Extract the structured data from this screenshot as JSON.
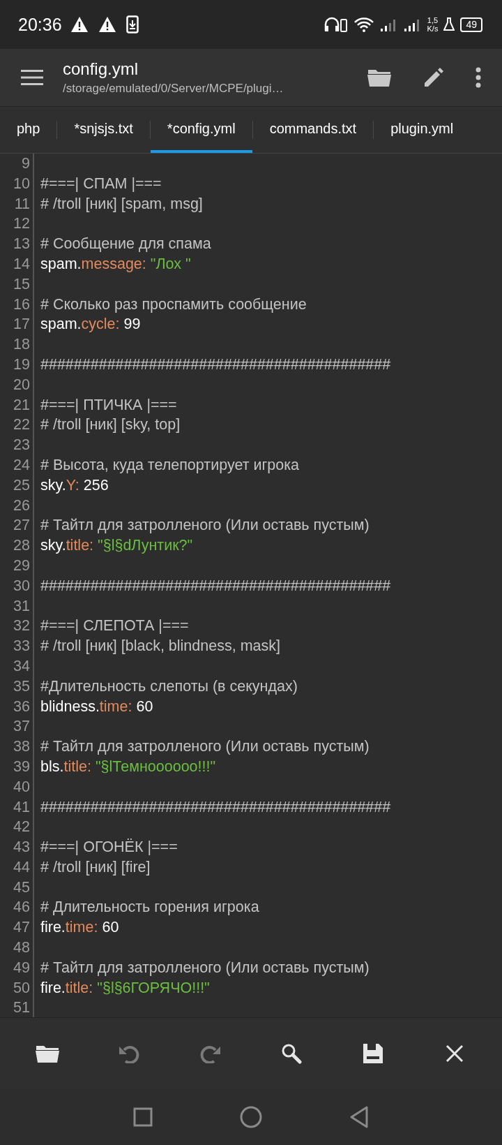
{
  "status_bar": {
    "time": "20:36",
    "left_icons": [
      {
        "kind": "warning"
      },
      {
        "kind": "warning"
      },
      {
        "kind": "download"
      }
    ],
    "speed_value": "1,5",
    "speed_unit": "K/s",
    "battery": "49"
  },
  "app_bar": {
    "title": "config.yml",
    "subtitle": "/storage/emulated/0/Server/MCPE/plugi…",
    "actions": [
      {
        "kind": "folder"
      },
      {
        "kind": "edit"
      },
      {
        "kind": "more"
      }
    ]
  },
  "tabs": [
    {
      "label": "php",
      "selected": false
    },
    {
      "label": "*snjsjs.txt",
      "selected": false
    },
    {
      "label": "*config.yml",
      "selected": true
    },
    {
      "label": "commands.txt",
      "selected": false
    },
    {
      "label": "plugin.yml",
      "selected": false
    }
  ],
  "editor": {
    "lines": [
      {
        "number": "9",
        "kind": "blank"
      },
      {
        "number": "10",
        "kind": "comment",
        "text": "#===| СПАМ |==="
      },
      {
        "number": "11",
        "kind": "comment",
        "text": "# /troll [ник] [spam, msg]"
      },
      {
        "number": "12",
        "kind": "blank"
      },
      {
        "number": "13",
        "kind": "comment",
        "text": "# Сообщение для спама"
      },
      {
        "number": "14",
        "kind": "entry",
        "key": "spam.",
        "field": "message:",
        "value": {
          "kind": "string",
          "text": "\"Лох \""
        }
      },
      {
        "number": "15",
        "kind": "blank"
      },
      {
        "number": "16",
        "kind": "comment",
        "text": "# Сколько раз проспамить сообщение"
      },
      {
        "number": "17",
        "kind": "entry",
        "key": "spam.",
        "field": "cycle:",
        "value": {
          "kind": "number",
          "text": "99"
        }
      },
      {
        "number": "18",
        "kind": "blank"
      },
      {
        "number": "19",
        "kind": "comment",
        "text": "##########################################"
      },
      {
        "number": "20",
        "kind": "blank"
      },
      {
        "number": "21",
        "kind": "comment",
        "text": "#===| ПТИЧКА |==="
      },
      {
        "number": "22",
        "kind": "comment",
        "text": "# /troll [ник] [sky, top]"
      },
      {
        "number": "23",
        "kind": "blank"
      },
      {
        "number": "24",
        "kind": "comment",
        "text": "# Высота, куда телепортирует игрока"
      },
      {
        "number": "25",
        "kind": "entry",
        "key": "sky.",
        "field": "Y:",
        "value": {
          "kind": "number",
          "text": "256"
        }
      },
      {
        "number": "26",
        "kind": "blank"
      },
      {
        "number": "27",
        "kind": "comment",
        "text": "# Тайтл для затролленого (Или оставь пустым)"
      },
      {
        "number": "28",
        "kind": "entry",
        "key": "sky.",
        "field": "title:",
        "value": {
          "kind": "string",
          "text": "\"§l§dЛунтик?\""
        }
      },
      {
        "number": "29",
        "kind": "blank"
      },
      {
        "number": "30",
        "kind": "comment",
        "text": "##########################################"
      },
      {
        "number": "31",
        "kind": "blank"
      },
      {
        "number": "32",
        "kind": "comment",
        "text": "#===| СЛЕПОТА |==="
      },
      {
        "number": "33",
        "kind": "comment",
        "text": "# /troll [ник] [black, blindness, mask]"
      },
      {
        "number": "34",
        "kind": "blank"
      },
      {
        "number": "35",
        "kind": "comment",
        "text": "#Длительность слепоты (в секундах)"
      },
      {
        "number": "36",
        "kind": "entry",
        "key": "blidness.",
        "field": "time:",
        "value": {
          "kind": "number",
          "text": "60"
        }
      },
      {
        "number": "37",
        "kind": "blank"
      },
      {
        "number": "38",
        "kind": "comment",
        "text": "# Тайтл для затролленого (Или оставь пустым)"
      },
      {
        "number": "39",
        "kind": "entry",
        "key": "bls.",
        "field": "title:",
        "value": {
          "kind": "string",
          "text": "\"§lТемноооооо!!!\""
        }
      },
      {
        "number": "40",
        "kind": "blank"
      },
      {
        "number": "41",
        "kind": "comment",
        "text": "##########################################"
      },
      {
        "number": "42",
        "kind": "blank"
      },
      {
        "number": "43",
        "kind": "comment",
        "text": "#===| ОГОНЁК |==="
      },
      {
        "number": "44",
        "kind": "comment",
        "text": "# /troll [ник] [fire]"
      },
      {
        "number": "45",
        "kind": "blank"
      },
      {
        "number": "46",
        "kind": "comment",
        "text": "# Длительность горения игрока"
      },
      {
        "number": "47",
        "kind": "entry",
        "key": "fire.",
        "field": "time:",
        "value": {
          "kind": "number",
          "text": "60"
        }
      },
      {
        "number": "48",
        "kind": "blank"
      },
      {
        "number": "49",
        "kind": "comment",
        "text": "# Тайтл для затролленого (Или оставь пустым)"
      },
      {
        "number": "50",
        "kind": "entry",
        "key": "fire.",
        "field": "title:",
        "value": {
          "kind": "string",
          "text": "\"§l§6ГОРЯЧО!!!\""
        }
      },
      {
        "number": "51",
        "kind": "blank"
      }
    ]
  },
  "toolbar": [
    {
      "kind": "folder",
      "disabled": false
    },
    {
      "kind": "undo",
      "disabled": true
    },
    {
      "kind": "redo",
      "disabled": true
    },
    {
      "kind": "search",
      "disabled": false
    },
    {
      "kind": "save",
      "disabled": false
    },
    {
      "kind": "close",
      "disabled": false
    }
  ],
  "nav_bar": [
    {
      "kind": "recents"
    },
    {
      "kind": "home"
    },
    {
      "kind": "back"
    }
  ]
}
